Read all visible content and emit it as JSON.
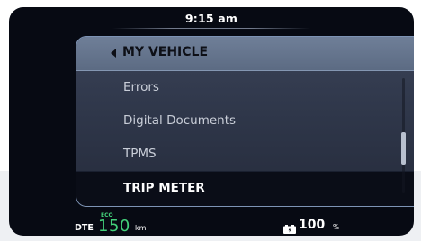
{
  "status_bar": {
    "time": "9:15 am"
  },
  "menu": {
    "title": "MY VEHICLE",
    "items": [
      {
        "label": "Errors",
        "selected": false
      },
      {
        "label": "Digital Documents",
        "selected": false
      },
      {
        "label": "TPMS",
        "selected": false
      },
      {
        "label": "TRIP METER",
        "selected": true
      }
    ],
    "scroll_position": 0.55
  },
  "bottom_bar": {
    "dte_label": "DTE",
    "mode": "ECO",
    "dte_value": "150",
    "dte_unit": "km",
    "battery_value": "100",
    "battery_unit": "%"
  },
  "colors": {
    "screen_bg": "#070a13",
    "panel_header": "#5c6b83",
    "panel_border": "#7d93b4",
    "eco_green": "#43d07a",
    "selected_bg": "#0a0d17"
  },
  "icons": {
    "back": "chevron-left-icon",
    "battery": "battery-icon"
  }
}
